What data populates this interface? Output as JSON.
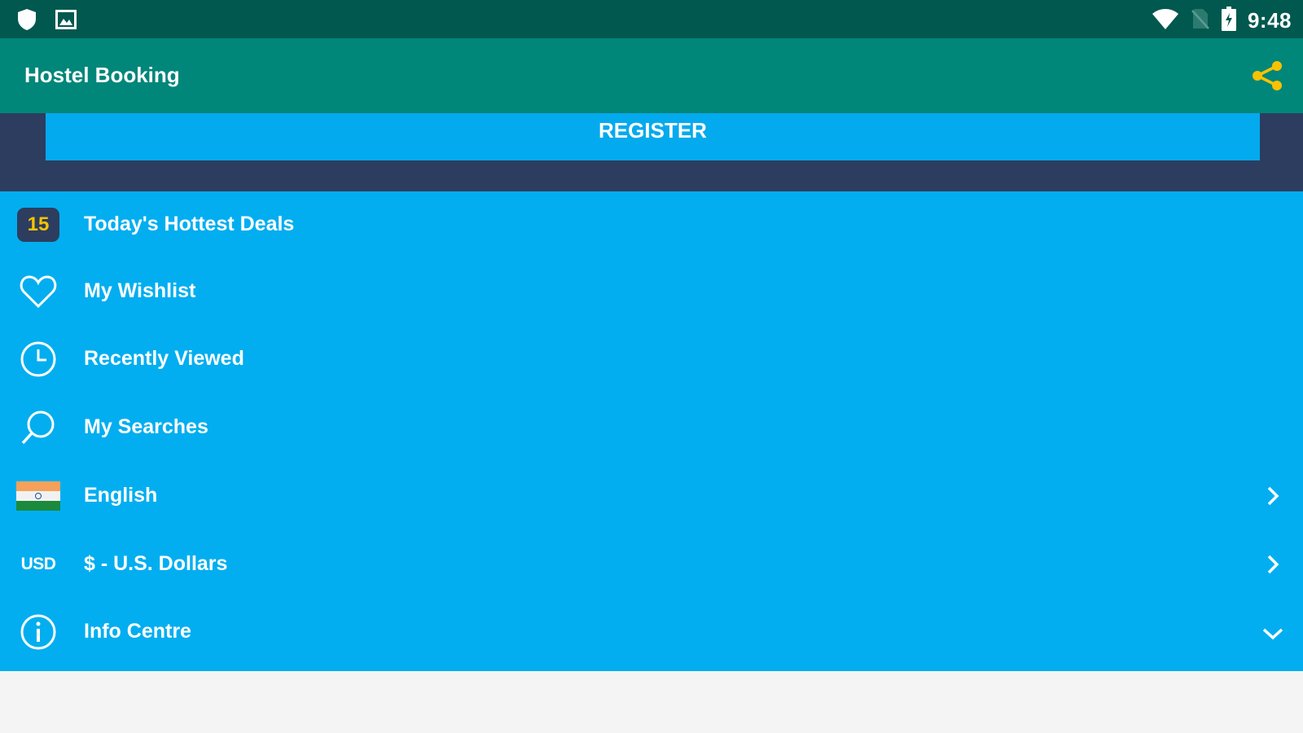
{
  "status_bar": {
    "time": "9:48",
    "icons": [
      "shield-icon",
      "image-icon",
      "wifi-icon",
      "no-sim-icon",
      "battery-charging-icon"
    ]
  },
  "app_bar": {
    "title": "Hostel Booking",
    "share_icon": "share-icon",
    "share_color": "#f8c200"
  },
  "register": {
    "label": "REGISTER"
  },
  "menu": {
    "deals": {
      "badge": "15",
      "label": "Today's Hottest Deals"
    },
    "wishlist": {
      "label": "My Wishlist",
      "icon": "heart-icon"
    },
    "recent": {
      "label": "Recently Viewed",
      "icon": "clock-icon"
    },
    "searches": {
      "label": "My Searches",
      "icon": "search-icon"
    },
    "language": {
      "label": "English",
      "icon": "india-flag-icon"
    },
    "currency": {
      "code": "USD",
      "label": "$ - U.S. Dollars"
    },
    "info": {
      "label": "Info Centre",
      "icon": "info-icon"
    }
  },
  "colors": {
    "status_bar": "#01584f",
    "app_bar": "#01867a",
    "register_bg": "#2c3d5f",
    "register_button": "#04aaee",
    "menu_bg": "#02aef0",
    "badge_text": "#f8c200"
  }
}
